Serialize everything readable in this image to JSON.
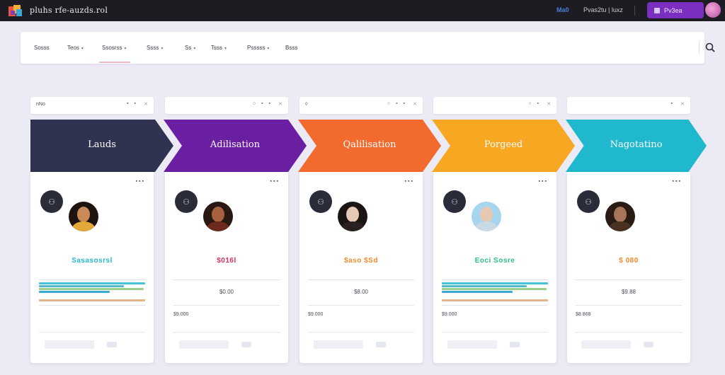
{
  "header": {
    "app_title": "pluhs rfe-auzds.rol",
    "link_blue": "Ma0",
    "user_link": "Pvas2tu | luxz",
    "cta_label": "Pv3ea"
  },
  "nav": {
    "items": [
      {
        "label": "Sosss",
        "caret": false
      },
      {
        "label": "Teos",
        "caret": true
      },
      {
        "label": "Ssosrss",
        "caret": true
      },
      {
        "label": "Ssss",
        "caret": true
      },
      {
        "label": "Ss",
        "caret": true
      },
      {
        "label": "Tsss",
        "caret": true
      },
      {
        "label": "Psssss",
        "caret": true
      },
      {
        "label": "Bsss",
        "caret": false
      }
    ],
    "caret_glyph": "▾",
    "active_index": 2
  },
  "columns": [
    {
      "toolbar_label": "nNo",
      "toolbar_icons": "▪ ▪",
      "stage": "Lauds",
      "color": "#2f3350",
      "amount": "Sasasosrsl",
      "amount_color": "#27b7c8",
      "sub": "",
      "sub2": "",
      "menu": "▪▪▪",
      "avatar_tones": [
        "#1d1410",
        "#c98a58",
        "#e2a93a"
      ]
    },
    {
      "toolbar_label": "",
      "toolbar_icons": "○ ▪ ▪",
      "stage": "Adilisation",
      "color": "#6a1fa3",
      "amount": "$016l",
      "amount_color": "#d92f5a",
      "sub": "$0.00",
      "sub2": "$9.000",
      "menu": "▪▪▪",
      "avatar_tones": [
        "#2a1813",
        "#a9623f",
        "#6b2a1d"
      ]
    },
    {
      "toolbar_label": "◊",
      "toolbar_icons": "○ ▪ ▪",
      "stage": "Qalilisation",
      "color": "#f26a2e",
      "amount": "$aso $Sd",
      "amount_color": "#f08a2c",
      "sub": "$8.00",
      "sub2": "$9.000",
      "menu": "▪▪▪",
      "avatar_tones": [
        "#1a1412",
        "#e7c8b5",
        "#2a2020"
      ]
    },
    {
      "toolbar_label": "",
      "toolbar_icons": "○ ▪",
      "stage": "Porgeed",
      "color": "#f7a722",
      "amount": "Eoci Sosre",
      "amount_color": "#2fb98c",
      "sub": "",
      "sub2": "$9.000",
      "menu": "▪▪▪",
      "avatar_tones": [
        "#a7d4ef",
        "#e7c9b1",
        "#c9d9e6"
      ]
    },
    {
      "toolbar_label": "",
      "toolbar_icons": "▪",
      "stage": "Nagotatino",
      "color": "#1fb8cc",
      "amount": "$ 080",
      "amount_color": "#f08a2c",
      "sub": "$9.88",
      "sub2": "$8.868",
      "menu": "▪▪▪",
      "avatar_tones": [
        "#2a1c14",
        "#a8745a",
        "#4a3020"
      ]
    }
  ]
}
